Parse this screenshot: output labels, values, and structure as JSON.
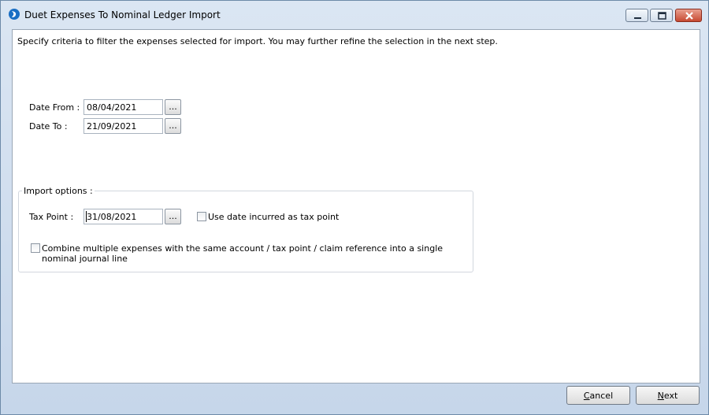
{
  "window": {
    "title": "Duet Expenses To Nominal Ledger Import"
  },
  "instructions": "Specify criteria to filter the expenses selected for import. You may further refine the selection in the next step.",
  "date_from": {
    "label": "Date From :",
    "value": "08/04/2021",
    "button": "..."
  },
  "date_to": {
    "label": "Date To :",
    "value": "21/09/2021",
    "button": "..."
  },
  "import_options": {
    "title": "Import options :",
    "tax_point": {
      "label": "Tax Point :",
      "value": "31/08/2021",
      "button": "..."
    },
    "use_date_incurred": {
      "label": "Use date incurred as tax point",
      "checked": false
    },
    "combine": {
      "label": "Combine multiple expenses with the same account / tax point / claim reference into a single nominal journal line",
      "checked": false
    }
  },
  "buttons": {
    "cancel": {
      "first": "C",
      "rest": "ancel"
    },
    "next": {
      "first": "N",
      "rest": "ext"
    }
  },
  "colors": {
    "accent": "#1a6fc4",
    "close": "#c74a33"
  }
}
